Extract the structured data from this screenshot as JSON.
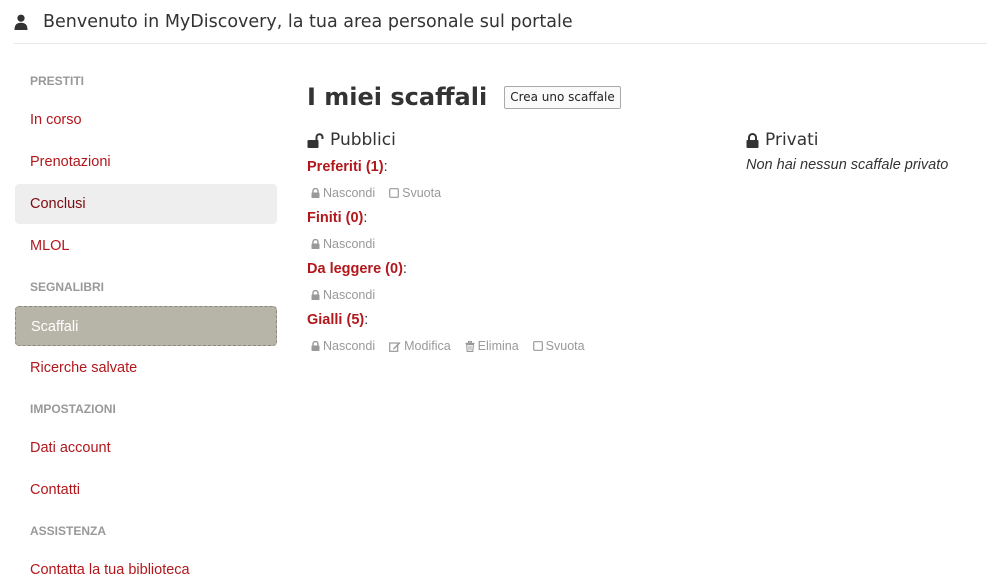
{
  "header": {
    "title": "Benvenuto in MyDiscovery, la tua area personale sul portale"
  },
  "sidebar": {
    "sections": [
      {
        "label": "PRESTITI",
        "items": [
          {
            "label": "In corso"
          },
          {
            "label": "Prenotazioni"
          },
          {
            "label": "Conclusi",
            "state": "hover"
          },
          {
            "label": "MLOL"
          }
        ]
      },
      {
        "label": "SEGNALIBRI",
        "items": [
          {
            "label": "Scaffali",
            "state": "active"
          },
          {
            "label": "Ricerche salvate"
          }
        ]
      },
      {
        "label": "IMPOSTAZIONI",
        "items": [
          {
            "label": "Dati account"
          },
          {
            "label": "Contatti"
          }
        ]
      },
      {
        "label": "ASSISTENZA",
        "items": [
          {
            "label": "Contatta la tua biblioteca"
          }
        ]
      }
    ]
  },
  "main": {
    "title": "I miei scaffali",
    "create_button": "Crea uno scaffale",
    "public": {
      "heading": "Pubblici",
      "shelves": [
        {
          "name": "Preferiti (1)",
          "actions": [
            "Nascondi",
            "Svuota"
          ]
        },
        {
          "name": "Finiti (0)",
          "actions": [
            "Nascondi"
          ]
        },
        {
          "name": "Da leggere (0)",
          "actions": [
            "Nascondi"
          ]
        },
        {
          "name": "Gialli (5)",
          "actions": [
            "Nascondi",
            "Modifica",
            "Elimina",
            "Svuota"
          ]
        }
      ]
    },
    "private": {
      "heading": "Privati",
      "empty_message": "Non hai nessun scaffale privato"
    }
  },
  "icons": {
    "Nascondi": "lock-icon",
    "Modifica": "edit-icon",
    "Elimina": "trash-icon",
    "Svuota": "checkbox-icon"
  },
  "colors": {
    "link": "#b2171c",
    "active_bg": "#b7b4a8",
    "hover_bg": "#eeeeee",
    "muted": "#999999"
  }
}
